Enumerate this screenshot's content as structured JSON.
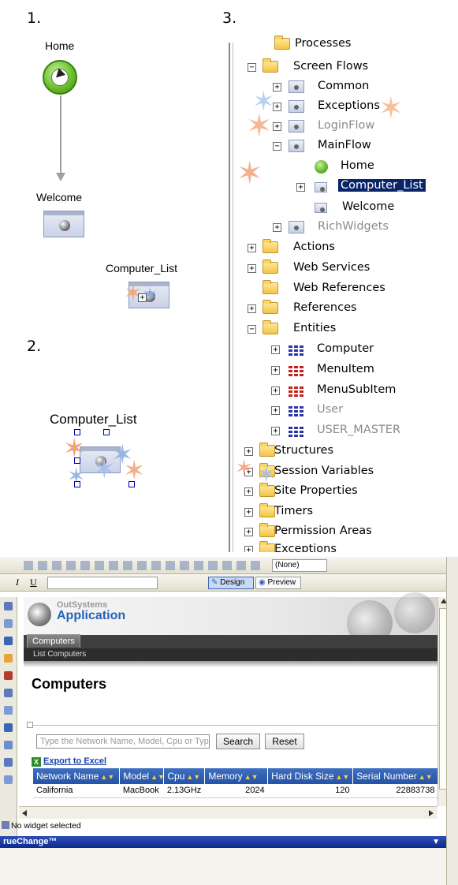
{
  "steps": {
    "one": "1.",
    "two": "2.",
    "three": "3."
  },
  "flow": {
    "home_label": "Home",
    "welcome_label": "Welcome",
    "computer_list_label": "Computer_List",
    "computer_list_label_2": "Computer_List"
  },
  "tree": {
    "processes": "Processes",
    "screen_flows": "Screen Flows",
    "common": "Common",
    "exceptions": "Exceptions",
    "loginflow": "LoginFlow",
    "mainflow": "MainFlow",
    "home": "Home",
    "computer_list": "Computer_List",
    "welcome": "Welcome",
    "richwidgets": "RichWidgets",
    "actions": "Actions",
    "web_services": "Web Services",
    "web_references": "Web References",
    "references": "References",
    "entities": "Entities",
    "computer": "Computer",
    "menuitem": "MenuItem",
    "menusubitem": "MenuSubItem",
    "user": "User",
    "user_master": "USER_MASTER",
    "structures": "Structures",
    "session_variables": "Session Variables",
    "site_properties": "Site Properties",
    "timers": "Timers",
    "permission_areas": "Permission Areas",
    "exceptions_folder": "Exceptions"
  },
  "ide": {
    "style_none": "(None)",
    "design_label": "Design",
    "preview_label": "Preview",
    "brand_top": "OutSystems",
    "brand_app": "Application",
    "tab_computers": "Computers",
    "breadcrumb": "List Computers",
    "page_title": "Computers",
    "search_placeholder": "Type the Network Name, Model, Cpu or Type",
    "search_button": "Search",
    "reset_button": "Reset",
    "export_label": "Export to Excel",
    "columns": [
      "Network Name",
      "Model",
      "Cpu",
      "Memory",
      "Hard Disk Size",
      "Serial Number"
    ],
    "row": [
      "California",
      "MacBook",
      "2.13GHz",
      "2024",
      "120",
      "22883738"
    ],
    "status_text": "No widget selected",
    "panel_title": "rueChange™"
  }
}
